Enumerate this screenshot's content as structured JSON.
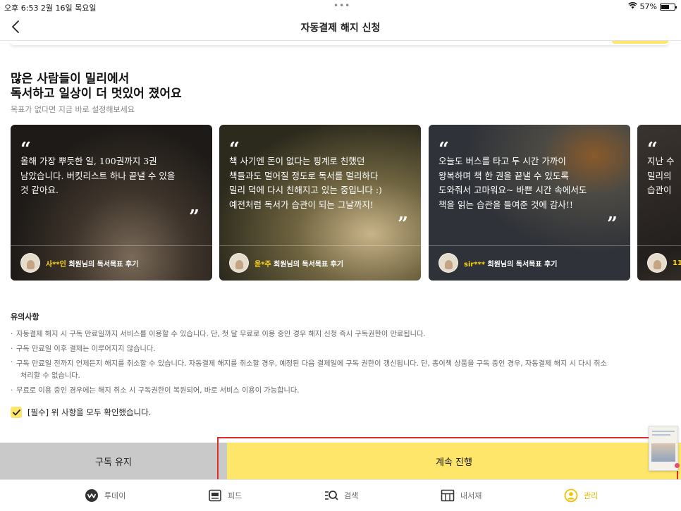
{
  "status_bar": {
    "time_date": "오후 6:53   2월 16일 목요일",
    "dots": "•••",
    "battery": "57%"
  },
  "nav": {
    "title": "자동결제 해지 신청",
    "back_icon": "chevron-left-icon"
  },
  "promo": {
    "headline_line1": "많은 사람들이 밀리에서",
    "headline_line2": "독서하고 일상이 더 멋있어 졌어요",
    "subheadline": "목표가 없다면 지금 바로 설정해보세요"
  },
  "reviews": [
    {
      "quote_open": "“",
      "quote_close": "”",
      "lines": [
        "올해 가장 뿌듯한 일, 100권까지 3권",
        "남았습니다. 버킷리스트 하나 끝낼 수 있을",
        "것 같아요."
      ],
      "name": "사**인",
      "suffix": " 회원님의 독서목표 후기",
      "bg": "#2b2520"
    },
    {
      "quote_open": "“",
      "quote_close": "”",
      "lines": [
        "책 사기엔 돈이 없다는 핑계로 친했던",
        "책들과도 멀어질 정도로 독서를 멀리하다",
        "밀리 덕에 다시 친해지고 있는 중입니다 :)",
        "예전처럼 독서가 습관이 되는 그날까지!"
      ],
      "name": "윤*주",
      "suffix": " 회원님의 독서목표 후기",
      "bg": "#3a3423"
    },
    {
      "quote_open": "“",
      "quote_close": "”",
      "lines": [
        "오늘도 버스를 타고 두 시간 가까이",
        "왕복하며 책 한 권을 끝낼 수 있도록",
        "도와줘서 고마워요~ 바쁜 시간 속에서도",
        "책을 읽는 습관을 들여준 것에 감사!!"
      ],
      "name": "sir***",
      "suffix": " 회원님의 독서목표 후기",
      "bg": "#3b4048"
    },
    {
      "quote_open": "“",
      "quote_close": "",
      "lines": [
        "지난 수",
        "밀리의 ",
        "습관이 "
      ],
      "name": "11",
      "suffix": "",
      "bg": "#2a2622"
    }
  ],
  "notice": {
    "title": "유의사항",
    "items": [
      "자동결제 해지 시 구독 만료일까지 서비스를 이용할 수 있습니다. 단, 첫 달 무료로 이용 중인 경우 해지 신청 즉시 구독권한이 만료됩니다.",
      "구독 만료일 이후 결제는 이루어지지 않습니다.",
      "구독 만료일 전까지 언제든지 해지를 취소할 수 있습니다. 자동결제 해지를 취소할 경우, 예정된 다음 결제일에 구독 권한이 갱신됩니다. 단, 종이책 상품을 구독 중인 경우, 자동결제 해지 시 다시 취소",
      "처리할 수 없습니다.",
      "무료로 이용 중인 경우에는 해지 취소 시 구독권한이 복원되어, 바로 서비스 이용이 가능합니다."
    ]
  },
  "agree": {
    "checked": true,
    "label": "[필수] 위 사항을 모두 확인했습니다."
  },
  "actions": {
    "keep_label": "구독 유지",
    "continue_label": "계속 진행",
    "accent_color": "#fde66a",
    "highlight_color": "#e02b2b"
  },
  "tabs": [
    {
      "label": "투데이",
      "icon": "today-icon"
    },
    {
      "label": "피드",
      "icon": "feed-icon"
    },
    {
      "label": "검색",
      "icon": "search-icon"
    },
    {
      "label": "내서재",
      "icon": "library-icon"
    },
    {
      "label": "관리",
      "icon": "profile-icon",
      "active": true
    }
  ]
}
